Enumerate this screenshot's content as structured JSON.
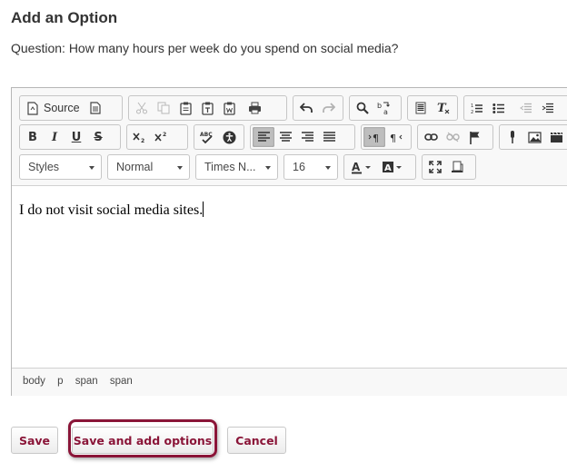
{
  "page": {
    "title": "Add an Option",
    "question": "Question: How many hours per week do you spend on social media?"
  },
  "toolbar": {
    "source_label": "Source",
    "styles_label": "Styles",
    "format_label": "Normal",
    "font_label": "Times N...",
    "size_label": "16",
    "bold_label": "B",
    "italic_label": "I",
    "underline_label": "U",
    "strike_label": "S"
  },
  "editor": {
    "content": "I do not visit social media sites."
  },
  "statusbar": {
    "path": [
      "body",
      "p",
      "span",
      "span"
    ]
  },
  "buttons": {
    "save": "Save",
    "save_add": "Save and add options",
    "cancel": "Cancel"
  },
  "colors": {
    "accent": "#8a1538",
    "active_button": "#bebebe"
  },
  "icons": [
    "source-icon",
    "templates-icon",
    "cut-icon",
    "copy-icon",
    "paste-icon",
    "paste-text-icon",
    "paste-word-icon",
    "print-icon",
    "undo-icon",
    "redo-icon",
    "find-icon",
    "replace-icon",
    "select-all-icon",
    "remove-format-icon",
    "numbered-list-icon",
    "bulleted-list-icon",
    "outdent-icon",
    "indent-icon",
    "subscript-icon",
    "superscript-icon",
    "spellcheck-icon",
    "accessibility-icon",
    "align-left-icon",
    "align-center-icon",
    "align-right-icon",
    "justify-icon",
    "ltr-icon",
    "rtl-icon",
    "link-icon",
    "unlink-icon",
    "anchor-icon",
    "mic-icon",
    "image-icon",
    "video-icon",
    "text-color-icon",
    "bg-color-icon",
    "maximize-icon",
    "show-blocks-icon"
  ]
}
